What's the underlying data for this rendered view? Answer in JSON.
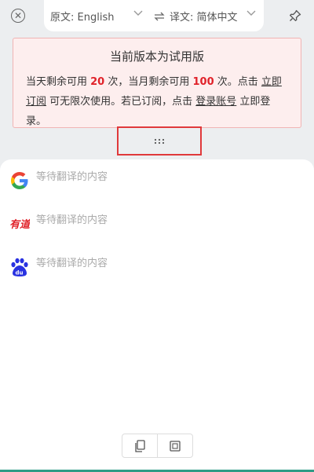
{
  "header": {
    "close_icon": "close-circle-icon",
    "source_lang_label": "原文: English",
    "swap_icon": "swap-arrows-icon",
    "target_lang_label": "译文: 简体中文",
    "pin_icon": "pin-icon"
  },
  "notice": {
    "title": "当前版本为试用版",
    "text_1": "当天剩余可用 ",
    "daily_count": "20",
    "text_2": " 次，当月剩余可用 ",
    "monthly_count": "100",
    "text_3": " 次。点击 ",
    "subscribe_link": "立即订阅",
    "text_4": " 可无限次使用。若已订阅，点击 ",
    "login_link": "登录账号",
    "text_5": " 立即登录。",
    "accent_color": "#e0222a"
  },
  "drag_handle": {
    "glyph": "⋮⋮⋮"
  },
  "results": [
    {
      "engine_icon": "google-logo-icon",
      "text": "等待翻译的内容"
    },
    {
      "engine_icon": "youdao-logo-icon",
      "text": "等待翻译的内容"
    },
    {
      "engine_icon": "baidu-logo-icon",
      "text": "等待翻译的内容"
    }
  ],
  "toolbar": {
    "copy_icon": "copy-icon",
    "screenshot_icon": "screenshot-icon"
  }
}
